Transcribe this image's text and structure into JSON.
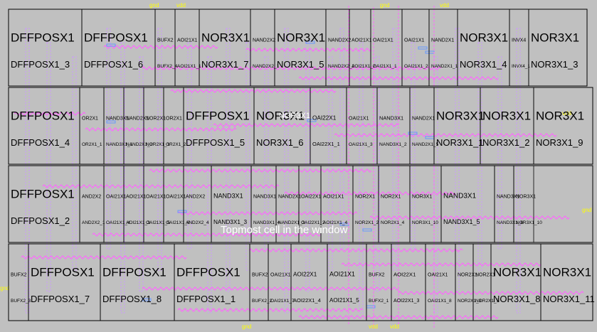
{
  "pins": [
    "gnd",
    "vdd",
    "gnd",
    "vdd",
    "gnd",
    "vdd",
    "vdd",
    "gnd",
    "gnd",
    "vdd"
  ],
  "overlay_text": "Topmost cell in the window",
  "center_label": "NOR3X1",
  "colors": {
    "background": "#c0c0c0",
    "cell_border": "#000000",
    "wire_magenta": "#ff66ff",
    "wire_violet": "#cc99ff",
    "wire_blue": "#6699ff",
    "pin_text": "#ffff00",
    "overlay_text": "#ffffff"
  },
  "rows": [
    {
      "cells": [
        {
          "type": "DFFPOSX1",
          "name": "DFFPOSX1_3"
        },
        {
          "type": "DFFPOSX1",
          "name": "DFFPOSX1_6"
        },
        {
          "type": "BUFX2",
          "name": "BUFX2_4"
        },
        {
          "type": "AOI21X1",
          "name": "AOI21X1_1"
        },
        {
          "type": "NOR3X1",
          "name": "NOR3X1_7"
        },
        {
          "type": "NAND2X2",
          "name": "NAND2X2_1"
        },
        {
          "type": "NOR3X1",
          "name": "NOR3X1_5"
        },
        {
          "type": "NAND2X2",
          "name": "NAND2X2_2"
        },
        {
          "type": "AOI21X1",
          "name": "AOI21X1_2"
        },
        {
          "type": "OAI21X1",
          "name": "OAI21X1_1"
        },
        {
          "type": "OAI21X1",
          "name": "OAI21X1_2"
        },
        {
          "type": "NAND2X1",
          "name": "NAND2X1_1"
        },
        {
          "type": "NOR3X1",
          "name": "NOR3X1_4"
        },
        {
          "type": "INVX4",
          "name": "INVX4_1"
        },
        {
          "type": "NOR3X1",
          "name": "NOR3X1_3"
        }
      ]
    },
    {
      "cells": [
        {
          "type": "DFFPOSX1",
          "name": "DFFPOSX1_4"
        },
        {
          "type": "OR2X1",
          "name": "OR2X1_1"
        },
        {
          "type": "NAND3X1",
          "name": "NAND3X1_1"
        },
        {
          "type": "NAND2X1",
          "name": "NAND2X1_2"
        },
        {
          "type": "NOR2X1",
          "name": "NOR2X1_1"
        },
        {
          "type": "OR2X1",
          "name": "OR2X1_2"
        },
        {
          "type": "DFFPOSX1",
          "name": "DFFPOSX1_5"
        },
        {
          "type": "NOR3X1",
          "name": "NOR3X1_6"
        },
        {
          "type": "OAI22X1",
          "name": "OAI22X1_1"
        },
        {
          "type": "OAI21X1",
          "name": "OAI21X1_3"
        },
        {
          "type": "NAND3X1",
          "name": "NAND3X1_2"
        },
        {
          "type": "NAND2X1",
          "name": "NAND2X1_5"
        },
        {
          "type": "NOR3X1",
          "name": "NOR3X1_1"
        },
        {
          "type": "NOR3X1",
          "name": "NOR3X1_2"
        },
        {
          "type": "NOR3X1",
          "name": "NOR3X1_9"
        }
      ]
    },
    {
      "cells": [
        {
          "type": "DFFPOSX1",
          "name": "DFFPOSX1_2"
        },
        {
          "type": "AND2X2",
          "name": "AND2X2_1"
        },
        {
          "type": "OAI21X1",
          "name": "OAI21X1_4"
        },
        {
          "type": "AOI21X1",
          "name": "AOI21X1_3"
        },
        {
          "type": "OAI21X1",
          "name": "OAI21X1_5"
        },
        {
          "type": "OAI21X1",
          "name": "OAI21X1_6"
        },
        {
          "type": "AND2X2",
          "name": "AND2X2_4"
        },
        {
          "type": "NAND3X1",
          "name": "NAND3X1_3"
        },
        {
          "type": "NAND3X1",
          "name": "NAND3X1_4"
        },
        {
          "type": "NAND2X1",
          "name": "NAND2X1_3"
        },
        {
          "type": "OAI22X1",
          "name": "OAI22X1_2"
        },
        {
          "type": "AOI21X1",
          "name": "AOI21X1_4"
        },
        {
          "type": "NOR2X1",
          "name": "NOR2X1_2"
        },
        {
          "type": "NOR2X1",
          "name": "NOR2X1_4"
        },
        {
          "type": "NOR3X1",
          "name": "NOR3X1_10"
        },
        {
          "type": "NAND3X1",
          "name": "NAND3X1_5"
        },
        {
          "type": "NAND3X1",
          "name": "NAND3X1_6"
        },
        {
          "type": "NOR3X1",
          "name": "NOR3X1_10"
        }
      ]
    },
    {
      "cells": [
        {
          "type": "BUFX2",
          "name": "BUFX2_3"
        },
        {
          "type": "DFFPOSX1",
          "name": "DFFPOSX1_7"
        },
        {
          "type": "DFFPOSX1",
          "name": "DFFPOSX1_8"
        },
        {
          "type": "DFFPOSX1",
          "name": "DFFPOSX1_1"
        },
        {
          "type": "BUFX2",
          "name": "BUFX2_2"
        },
        {
          "type": "OAI21X1",
          "name": "OAI21X1_7"
        },
        {
          "type": "AOI22X1",
          "name": "AOI22X1_4"
        },
        {
          "type": "AOI21X1",
          "name": "AOI21X1_5"
        },
        {
          "type": "BUFX2",
          "name": "BUFX2_1"
        },
        {
          "type": "AOI22X1",
          "name": "AOI22X1_3"
        },
        {
          "type": "OAI21X1",
          "name": "OAI21X1_8"
        },
        {
          "type": "NOR2X1",
          "name": "NOR2X1_3"
        },
        {
          "type": "NOR2X1",
          "name": "NOR2X1_5"
        },
        {
          "type": "NOR3X1",
          "name": "NOR3X1_8"
        },
        {
          "type": "NOR3X1",
          "name": "NOR3X1_11"
        }
      ]
    }
  ]
}
